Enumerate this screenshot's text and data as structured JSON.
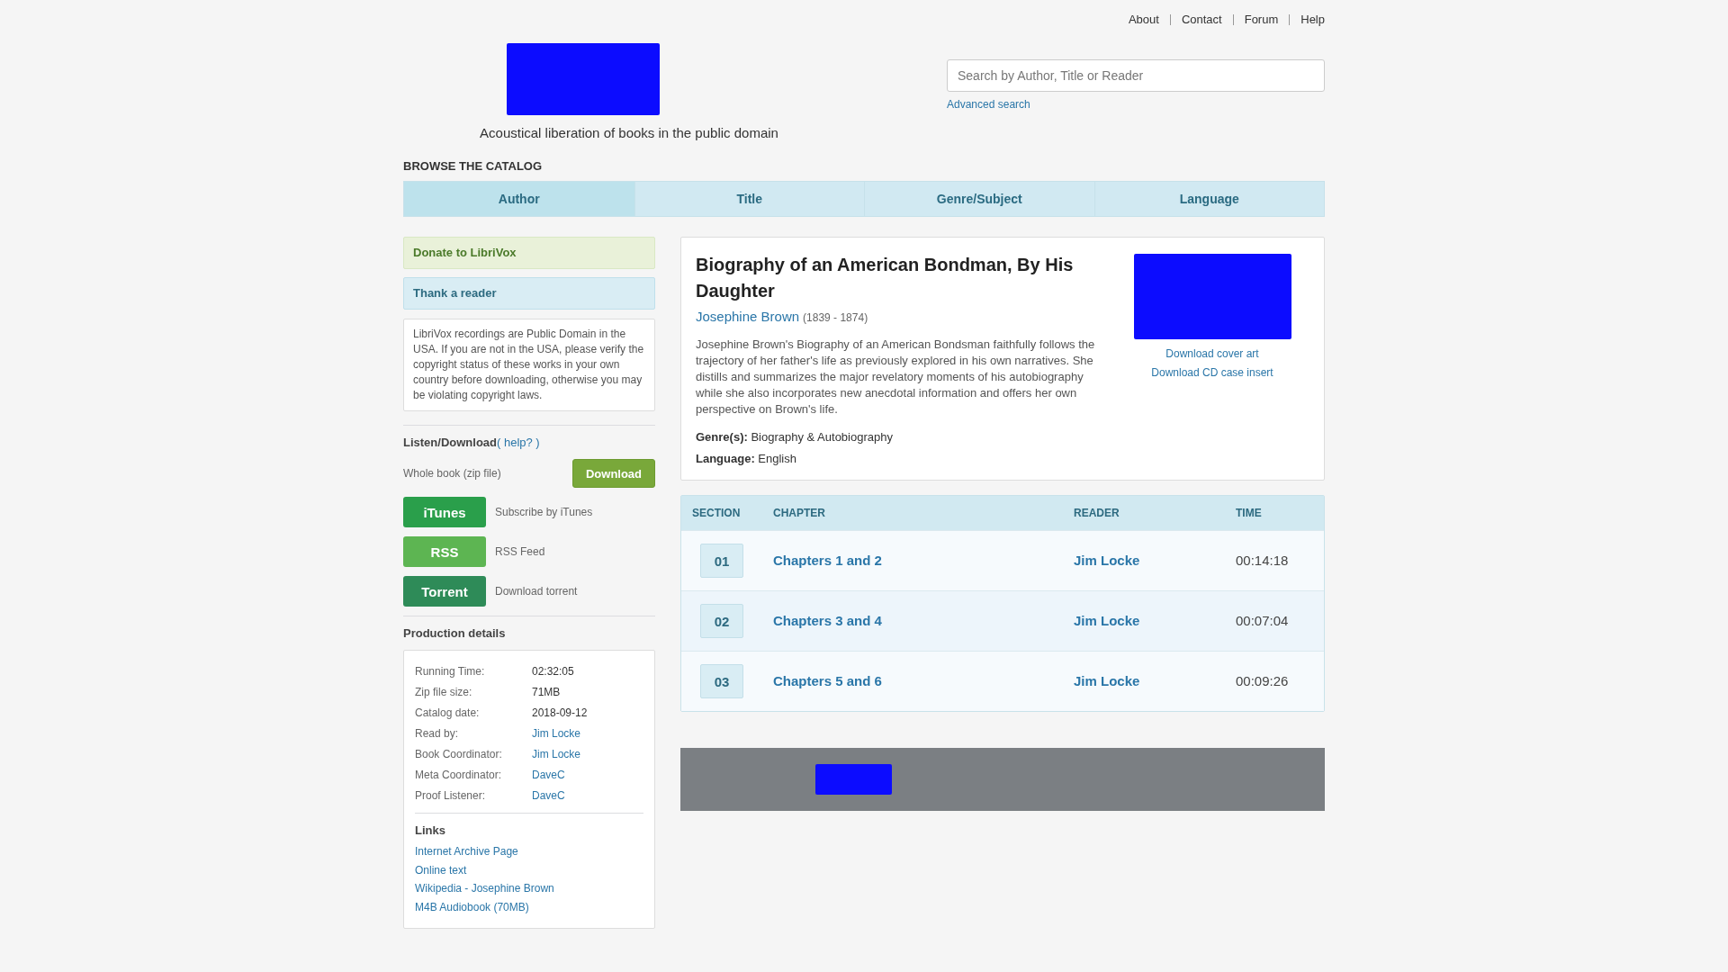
{
  "top_nav": {
    "links": [
      "About",
      "Contact",
      "Forum",
      "Help"
    ]
  },
  "header": {
    "tagline": "Acoustical liberation of books in the public domain",
    "search": {
      "placeholder": "Search by Author, Title or Reader"
    },
    "advanced_search": "Advanced search"
  },
  "browse": {
    "heading": "BROWSE THE CATALOG",
    "tabs": [
      {
        "label": "Author",
        "selected": true
      },
      {
        "label": "Title",
        "selected": false
      },
      {
        "label": "Genre/Subject",
        "selected": false
      },
      {
        "label": "Language",
        "selected": false
      }
    ]
  },
  "sidebar": {
    "donate": "Donate to LibriVox",
    "thank_reader": "Thank a reader",
    "notice": "LibriVox recordings are Public Domain in the USA. If you are not in the USA, please verify the copyright status of these works in your own country before downloading, otherwise you may be violating copyright laws.",
    "listen": {
      "heading": "Listen/Download",
      "help": "( help? )",
      "whole_book": "Whole book (zip file)",
      "download": "Download",
      "feeds": [
        {
          "button": "iTunes",
          "label": "Subscribe by iTunes",
          "color": "#2a9f4b"
        },
        {
          "button": "RSS",
          "label": "RSS Feed",
          "color": "#5db552"
        },
        {
          "button": "Torrent",
          "label": "Download torrent",
          "color": "#2e8b58"
        }
      ]
    },
    "production": {
      "heading": "Production details",
      "details": [
        {
          "kind": "text",
          "label": "Running Time:",
          "value": "02:32:05"
        },
        {
          "kind": "text",
          "label": "Zip file size:",
          "value": "71MB"
        },
        {
          "kind": "text",
          "label": "Catalog date:",
          "value": "2018-09-12"
        },
        {
          "kind": "link",
          "label": "Read by:",
          "value": "Jim Locke"
        },
        {
          "kind": "link",
          "label": "Book Coordinator:",
          "value": "Jim Locke"
        },
        {
          "kind": "link",
          "label": "Meta Coordinator:",
          "value": "DaveC"
        },
        {
          "kind": "link",
          "label": "Proof Listener:",
          "value": "DaveC"
        }
      ],
      "links_heading": "Links",
      "links": [
        "Internet Archive Page",
        "Online text",
        "Wikipedia - Josephine Brown",
        "M4B Audiobook (70MB)"
      ]
    }
  },
  "book": {
    "title": "Biography of an American Bondman, By His Daughter",
    "author": "Josephine Brown",
    "dates": "(1839 - 1874)",
    "description": "Josephine Brown's Biography of an American Bondsman faithfully follows the trajectory of her father's life as previously explored in his own narratives. She distills and summarizes the major revelatory moments of his autobiography while she also incorporates new anecdotal information and offers her own perspective on Brown's life.",
    "genre": {
      "label": "Genre(s):",
      "value": "Biography & Autobiography"
    },
    "language": {
      "label": "Language:",
      "value": "English"
    },
    "cover_links": [
      "Download cover art",
      "Download CD case insert"
    ]
  },
  "sections": {
    "columns": [
      "SECTION",
      "CHAPTER",
      "READER",
      "TIME"
    ],
    "rows": [
      {
        "section": "01",
        "chapter": "Chapters 1 and 2",
        "reader": "Jim Locke",
        "time": "00:14:18"
      },
      {
        "section": "02",
        "chapter": "Chapters 3 and 4",
        "reader": "Jim Locke",
        "time": "00:07:04"
      },
      {
        "section": "03",
        "chapter": "Chapters 5 and 6",
        "reader": "Jim Locke",
        "time": "00:09:26"
      }
    ]
  }
}
